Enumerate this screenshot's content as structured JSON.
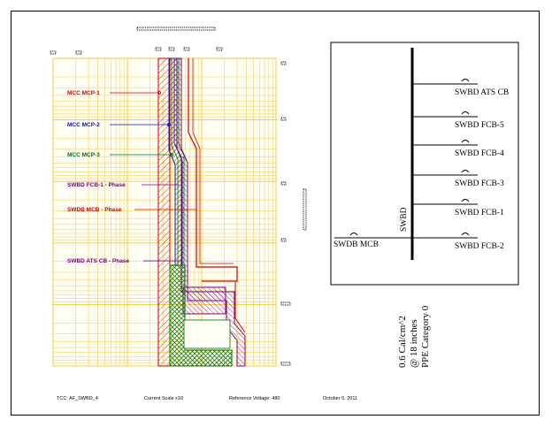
{
  "tcc": {
    "labels": [
      {
        "text": "MCC MCP-1",
        "color": "#d00000"
      },
      {
        "text": "MCC MCP-2",
        "color": "#1010c0"
      },
      {
        "text": "MCC MCP-3",
        "color": "#007000"
      },
      {
        "text": "SWBD FCB-1 - Phase",
        "color": "#800080"
      },
      {
        "text": "SWDB MCB - Phase",
        "color": "#d00000"
      },
      {
        "text": "SWBD ATS CB - Phase",
        "color": "#800080"
      }
    ],
    "grid_color": "#f5c842"
  },
  "oneline": {
    "bus_label": "SWBD",
    "main_label": "SWDB MCB",
    "feeders": [
      "SWBD ATS CB",
      "SWBD FCB-5",
      "SWBD FCB-4",
      "SWBD FCB-3",
      "SWBD FCB-1",
      "SWBD FCB-2"
    ]
  },
  "arc_flash": {
    "line1": "0.6 Cal/cm^2",
    "line2": "@ 18 inches",
    "line3": "PPE Category 0"
  },
  "footer": {
    "tcc": "TCC: AF_SWBD_4",
    "scale": "Current Scale x10",
    "voltage": "Reference Voltage: 480",
    "date": "October 5, 2011"
  }
}
